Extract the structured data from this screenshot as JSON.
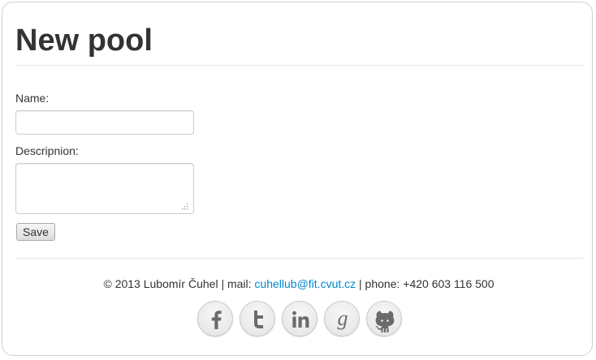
{
  "page": {
    "title": "New pool"
  },
  "form": {
    "name_label": "Name:",
    "name_value": "",
    "description_label": "Descripnion:",
    "description_value": "",
    "save_label": "Save"
  },
  "footer": {
    "copyright": "© 2013 Lubomír Čuhel | mail:",
    "email": "cuhellub@fit.cvut.cz",
    "phone": "| phone: +420 603 116 500",
    "link_color": "#0088cc"
  },
  "social": [
    {
      "icon": "facebook-icon",
      "glyph": "f"
    },
    {
      "icon": "twitter-icon",
      "glyph": "t"
    },
    {
      "icon": "linkedin-icon",
      "glyph": "in"
    },
    {
      "icon": "google-plus-icon",
      "glyph": "g"
    },
    {
      "icon": "github-icon",
      "glyph": "octocat"
    }
  ]
}
